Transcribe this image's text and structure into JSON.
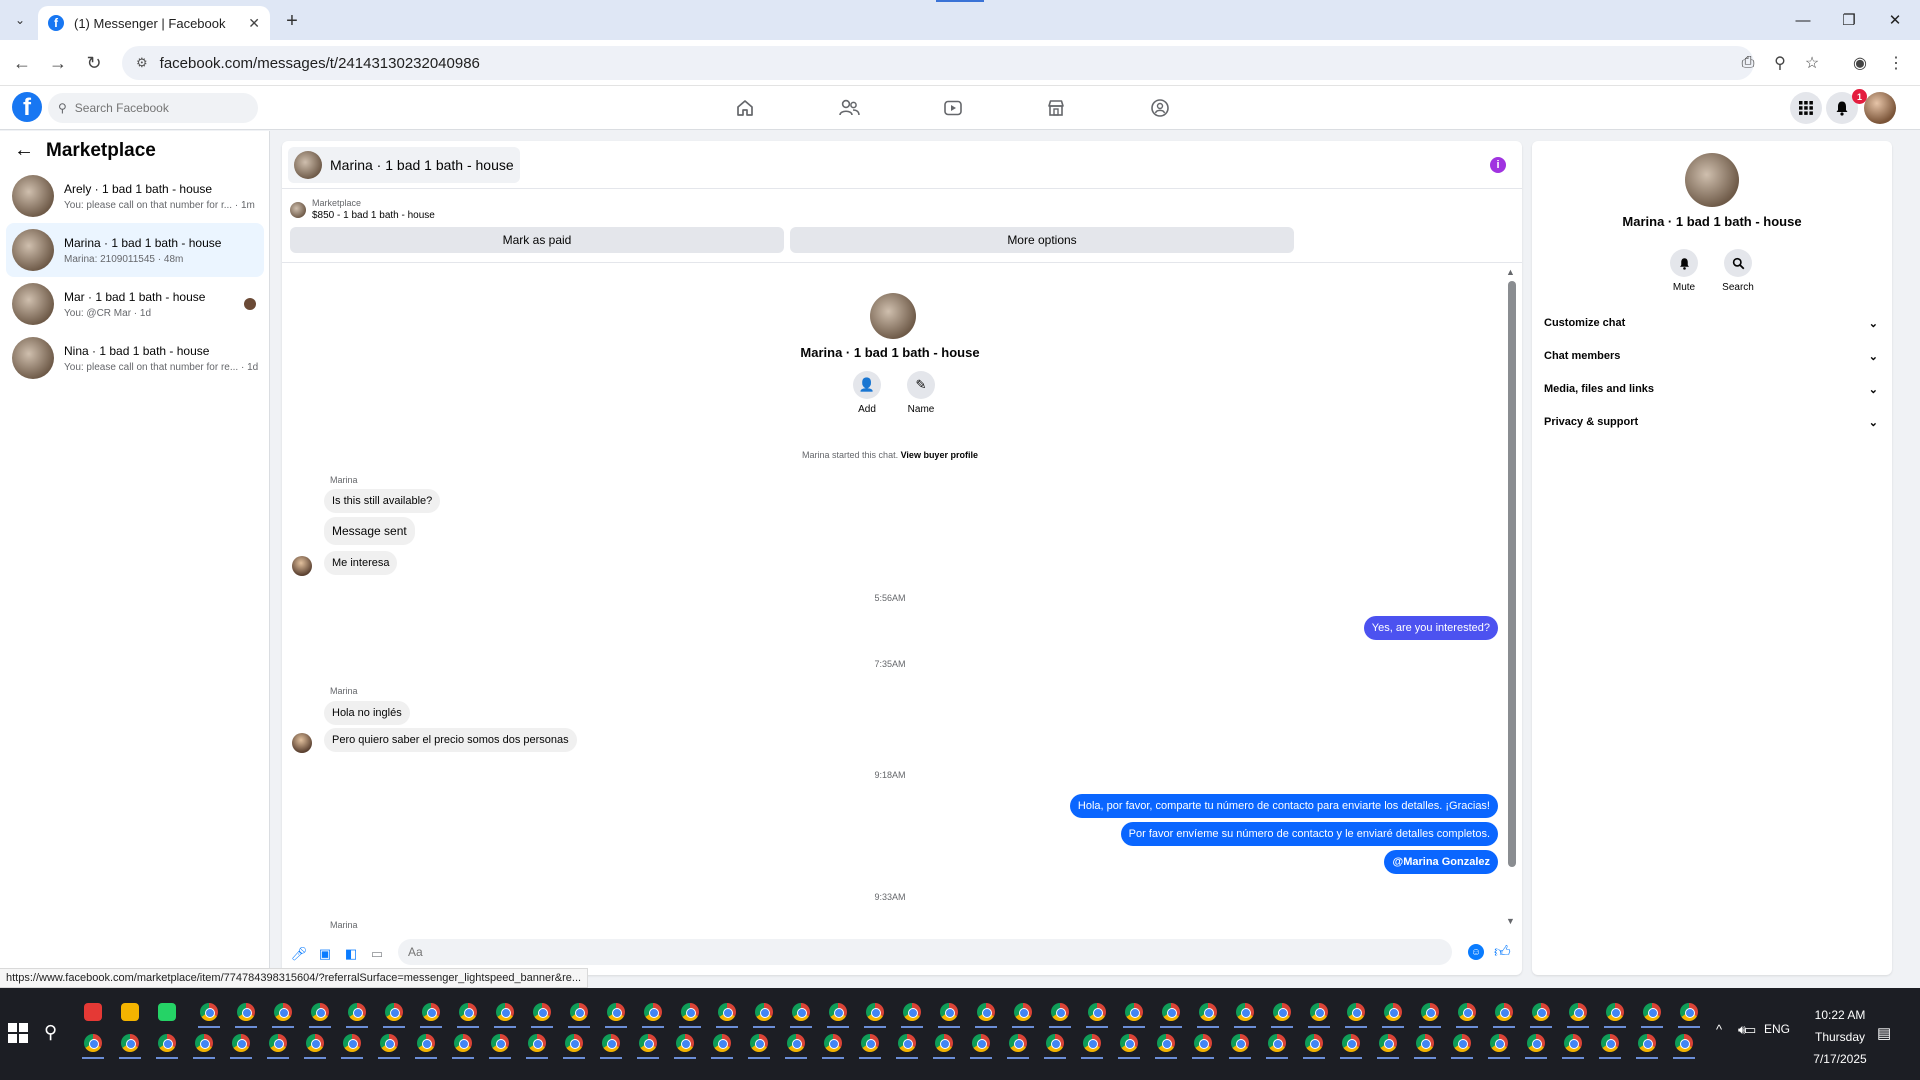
{
  "browser": {
    "tab_title": "(1) Messenger | Facebook",
    "url": "facebook.com/messages/t/24143130232040986",
    "status_url": "https://www.facebook.com/marketplace/item/774784398315604/?referralSurface=messenger_lightspeed_banner&re..."
  },
  "header": {
    "search_placeholder": "Search Facebook",
    "notification_count": "1"
  },
  "sidebar": {
    "title": "Marketplace",
    "conversations": [
      {
        "name": "Arely · 1 bad 1 bath - house",
        "preview": "You: please call on that number for r... · 1m",
        "active": false
      },
      {
        "name": "Marina · 1 bad 1 bath - house",
        "preview": "Marina: 2109011545 · 48m",
        "active": true
      },
      {
        "name": "Mar · 1 bad 1 bath - house",
        "preview": "You: @CR Mar · 1d",
        "active": false
      },
      {
        "name": "Nina · 1 bad 1 bath - house",
        "preview": "You: please call on that number for re... · 1d",
        "active": false
      }
    ]
  },
  "chat": {
    "title": "Marina · 1 bad 1 bath - house",
    "marketplace_label": "Marketplace",
    "listing": "$850 - 1 bad 1 bath - house",
    "mark_paid_label": "Mark as paid",
    "more_options_label": "More options",
    "intro_name": "Marina · 1 bad 1 bath - house",
    "add_label": "Add",
    "name_label": "Name",
    "started_text": "Marina started this chat.",
    "view_profile_label": "View buyer profile",
    "sender_name": "Marina",
    "messages_in_1": [
      "Is this still available?",
      "Message sent",
      "Me interesa"
    ],
    "time_1": "5:56AM",
    "msg_out_1": "Yes, are you interested?",
    "time_2": "7:35AM",
    "messages_in_2": [
      "Hola no inglés",
      "Pero quiero saber el precio somos dos personas"
    ],
    "time_3": "9:18AM",
    "messages_out_2": [
      "Hola, por favor, comparte tu número de contacto para enviarte los detalles. ¡Gracias!",
      "Por favor envíeme su número de contacto y le enviaré detalles completos.",
      "@Marina Gonzalez"
    ],
    "time_4": "9:33AM",
    "composer_placeholder": "Aa"
  },
  "info_panel": {
    "name": "Marina · 1 bad 1 bath - house",
    "mute_label": "Mute",
    "search_label": "Search",
    "sections": [
      "Customize chat",
      "Chat members",
      "Media, files and links",
      "Privacy & support"
    ]
  },
  "taskbar": {
    "time": "10:22 AM",
    "day": "Thursday",
    "date": "7/17/2025",
    "language": "ENG"
  },
  "colors": {
    "facebook_blue": "#1877f2",
    "outgoing_bubble": "#0a66ff",
    "first_outgoing_bubble": "#4c52f0",
    "incoming_bubble": "#f0f0f0",
    "active_conversation": "#ebf5ff"
  }
}
